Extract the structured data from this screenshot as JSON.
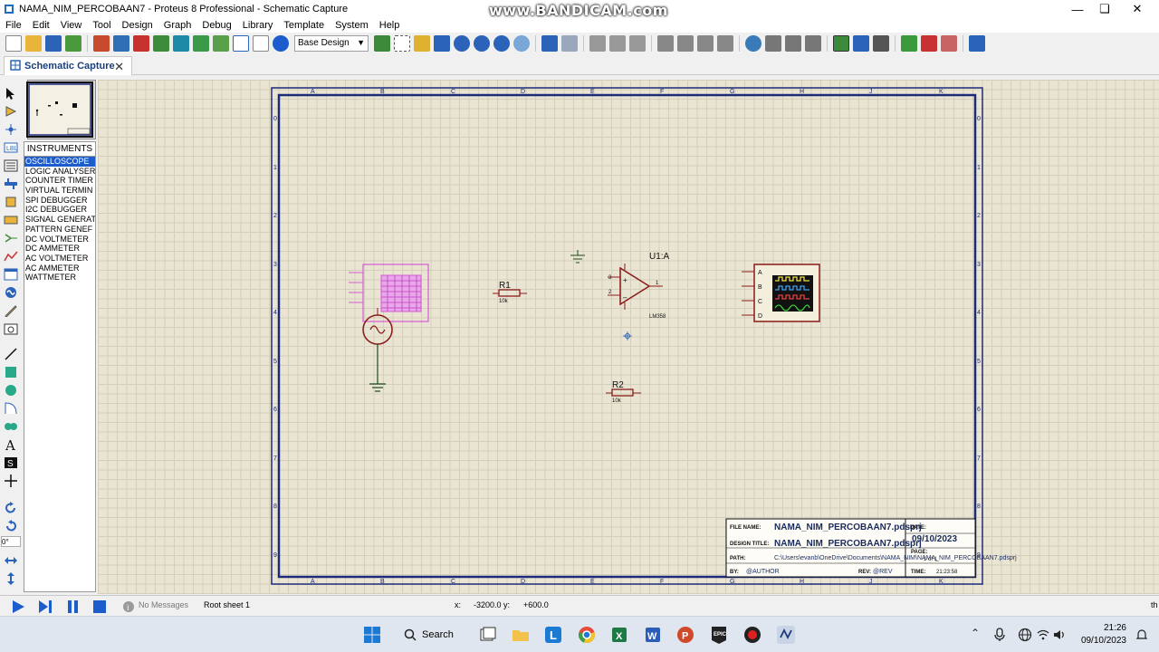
{
  "window": {
    "title": "NAMA_NIM_PERCOBAAN7 - Proteus 8 Professional - Schematic Capture"
  },
  "watermark": "www.BANDICAM.com",
  "menu": [
    "File",
    "Edit",
    "View",
    "Tool",
    "Design",
    "Graph",
    "Debug",
    "Library",
    "Template",
    "System",
    "Help"
  ],
  "toolbar": {
    "design_combo": "Base Design"
  },
  "tab": {
    "label": "Schematic Capture"
  },
  "devices": {
    "header": "INSTRUMENTS",
    "items": [
      "OSCILLOSCOPE",
      "LOGIC ANALYSER",
      "COUNTER TIMER",
      "VIRTUAL TERMIN",
      "SPI DEBUGGER",
      "I2C DEBUGGER",
      "SIGNAL GENERAT",
      "PATTERN GENEF",
      "DC VOLTMETER",
      "DC AMMETER",
      "AC VOLTMETER",
      "AC AMMETER",
      "WATTMETER"
    ]
  },
  "rotation": "0°",
  "sheet": {
    "col_labels": [
      "A",
      "B",
      "C",
      "D",
      "E",
      "F",
      "G",
      "H",
      "J",
      "K"
    ],
    "row_labels": [
      "0",
      "1",
      "2",
      "3",
      "4",
      "5",
      "6",
      "7",
      "8",
      "9"
    ]
  },
  "components": {
    "r1_ref": "R1",
    "r1_val": "10k",
    "r2_ref": "R2",
    "r2_val": "10k",
    "u1_ref": "U1:A",
    "u1_part": "LM358",
    "pin3": "3",
    "pin2": "2",
    "pin1": "1",
    "scope_channels": [
      "A",
      "B",
      "C",
      "D"
    ]
  },
  "title_block": {
    "file_name_label": "FILE NAME:",
    "file_name": "NAMA_NIM_PERCOBAAN7.pdsprj",
    "date_label": "DATE:",
    "date": "09/10/2023",
    "design_title_label": "DESIGN TITLE:",
    "design_title": "NAMA_NIM_PERCOBAAN7.pdsprj",
    "page_label": "PAGE:",
    "page": "1 of 1",
    "path_label": "PATH:",
    "path": "C:\\Users\\evanb\\OneDrive\\Documents\\NAMA_NIM\\NAMA_NIM_PERCOBAAN7.pdsprj",
    "by_label": "BY:",
    "by": "@AUTHOR",
    "rev_label": "REV:",
    "rev": "@REV",
    "time_label": "TIME:",
    "time": "21:23:58"
  },
  "status": {
    "messages": "No Messages",
    "sheet": "Root sheet 1",
    "x_label": "x:",
    "x": "-3200.0",
    "y_label": "y:",
    "y": "+600.0",
    "edge_text": "th"
  },
  "taskbar": {
    "search": "Search",
    "time": "21:26",
    "date": "09/10/2023"
  },
  "colors": {
    "sheet_border": "#1c2a7a",
    "component": "#8b1a1a",
    "generator": "#d65ad6",
    "selection": "#1c5ccc"
  }
}
